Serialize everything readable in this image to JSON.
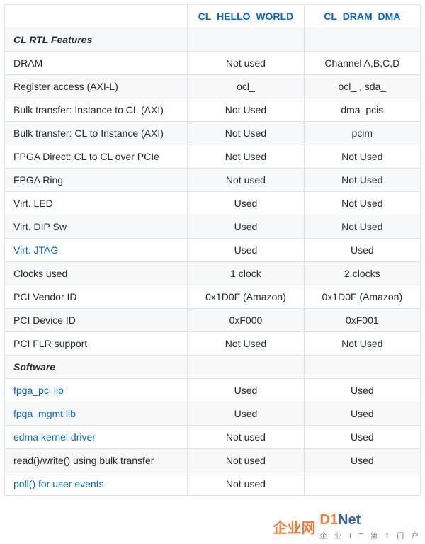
{
  "headers": {
    "col0": "",
    "col1": "CL_HELLO_WORLD",
    "col2": "CL_DRAM_DMA"
  },
  "sections": {
    "rtl": "CL RTL Features",
    "software": "Software"
  },
  "rows": {
    "dram": {
      "label": "DRAM",
      "c1": "Not used",
      "c2": "Channel A,B,C,D"
    },
    "regaccess": {
      "label": "Register access (AXI-L)",
      "c1": "ocl_",
      "c2": "ocl_ , sda_"
    },
    "bulk_i2c": {
      "label": "Bulk transfer: Instance to CL (AXI)",
      "c1": "Not Used",
      "c2": "dma_pcis"
    },
    "bulk_c2i": {
      "label": "Bulk transfer: CL to Instance (AXI)",
      "c1": "Not Used",
      "c2": "pcim"
    },
    "fpga_direct": {
      "label": "FPGA Direct: CL to CL over PCIe",
      "c1": "Not Used",
      "c2": "Not Used"
    },
    "fpga_ring": {
      "label": "FPGA Ring",
      "c1": "Not used",
      "c2": "Not Used"
    },
    "virt_led": {
      "label": "Virt. LED",
      "c1": "Used",
      "c2": "Not Used"
    },
    "virt_dip": {
      "label": "Virt. DIP Sw",
      "c1": "Used",
      "c2": "Not Used"
    },
    "virt_jtag": {
      "label": "Virt. JTAG",
      "c1": "Used",
      "c2": "Used"
    },
    "clocks": {
      "label": "Clocks used",
      "c1": "1 clock",
      "c2": "2 clocks"
    },
    "vendor": {
      "label": "PCI Vendor ID",
      "c1": "0x1D0F (Amazon)",
      "c2": "0x1D0F (Amazon)"
    },
    "device": {
      "label": "PCI Device ID",
      "c1": "0xF000",
      "c2": "0xF001"
    },
    "flr": {
      "label": "PCI FLR support",
      "c1": "Not Used",
      "c2": "Not Used"
    },
    "fpga_pci": {
      "label": "fpga_pci lib",
      "c1": "Used",
      "c2": "Used"
    },
    "fpga_mgmt": {
      "label": "fpga_mgmt lib",
      "c1": "Used",
      "c2": "Used"
    },
    "edma": {
      "label": "edma kernel driver",
      "c1": "Not used",
      "c2": "Used"
    },
    "readwrite": {
      "label": "read()/write() using bulk transfer",
      "c1": "Not used",
      "c2": "Used"
    },
    "poll": {
      "label": "poll() for user events",
      "c1": "Not used",
      "c2": ""
    }
  },
  "watermark": {
    "brand1": "企业网",
    "brand2a": "D1",
    "brand2b": "Net",
    "sub": "企 业 I T 第 1 门 户"
  }
}
